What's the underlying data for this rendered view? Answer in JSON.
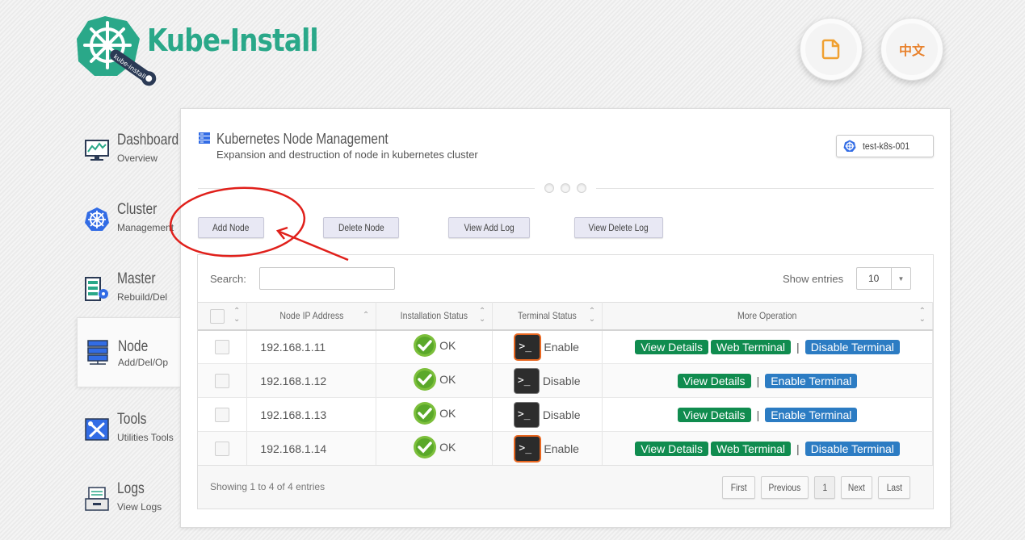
{
  "app": {
    "title": "Kube-Install",
    "logo_banner": "kube-install"
  },
  "header": {
    "lang_button_label": "中文"
  },
  "sidebar": {
    "items": [
      {
        "title": "Dashboard",
        "subtitle": "Overview"
      },
      {
        "title": "Cluster",
        "subtitle": "Management"
      },
      {
        "title": "Master",
        "subtitle": "Rebuild/Del"
      },
      {
        "title": "Node",
        "subtitle": "Add/Del/Op"
      },
      {
        "title": "Tools",
        "subtitle": "Utilities Tools"
      },
      {
        "title": "Logs",
        "subtitle": "View Logs"
      }
    ],
    "active_index": 3
  },
  "panel": {
    "title": "Kubernetes Node Management",
    "subtitle": "Expansion and destruction of node in kubernetes cluster",
    "cluster_name": "test-k8s-001"
  },
  "actions": {
    "add_node": "Add Node",
    "delete_node": "Delete Node",
    "view_add_log": "View Add Log",
    "view_delete_log": "View Delete Log"
  },
  "table": {
    "search_label": "Search:",
    "search_value": "",
    "show_entries_label": "Show entries",
    "entries_value": "10",
    "columns": [
      "Node IP Address",
      "Installation Status",
      "Terminal Status",
      "More Operation"
    ],
    "rows": [
      {
        "ip": "192.168.1.11",
        "install_status": "OK",
        "terminal_status": "Enable"
      },
      {
        "ip": "192.168.1.12",
        "install_status": "OK",
        "terminal_status": "Disable"
      },
      {
        "ip": "192.168.1.13",
        "install_status": "OK",
        "terminal_status": "Disable"
      },
      {
        "ip": "192.168.1.14",
        "install_status": "OK",
        "terminal_status": "Enable"
      }
    ],
    "op_labels": {
      "view_details": "View Details",
      "web_terminal": "Web Terminal",
      "disable_terminal": "Disable Terminal",
      "enable_terminal": "Enable Terminal"
    },
    "info": "Showing 1 to 4 of 4 entries",
    "pager": {
      "first": "First",
      "previous": "Previous",
      "current": "1",
      "next": "Next",
      "last": "Last"
    }
  },
  "colors": {
    "brand": "#2aa889",
    "accent_orange": "#e8822d",
    "ok_green": "#108c4f",
    "link_blue": "#2c7cc3",
    "annotation_red": "#e0201b"
  },
  "icons": {
    "doc_button": "document-icon",
    "cluster": "kubernetes-helm-icon",
    "panel": "server-stack-icon"
  }
}
